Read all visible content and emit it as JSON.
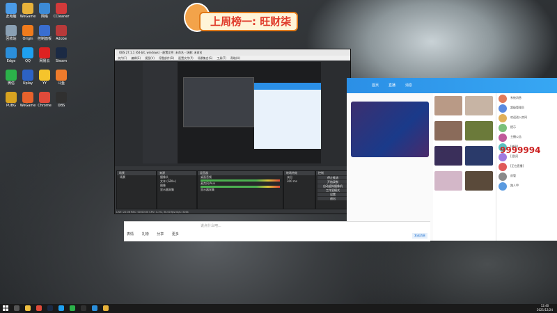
{
  "banner": {
    "text": "上周榜一: 旺财柒"
  },
  "desktop_icons": [
    {
      "label": "此电脑",
      "color": "#4a9be8"
    },
    {
      "label": "WeGame",
      "color": "#e8b23a"
    },
    {
      "label": "网络",
      "color": "#3c8ad6"
    },
    {
      "label": "CCleaner",
      "color": "#d23a3a"
    },
    {
      "label": "回收站",
      "color": "#8aa0b4"
    },
    {
      "label": "Origin",
      "color": "#f07b1c"
    },
    {
      "label": "控制面板",
      "color": "#3a6ed0"
    },
    {
      "label": "Adobe",
      "color": "#b83a3a"
    },
    {
      "label": "Edge",
      "color": "#2b8fdb"
    },
    {
      "label": "QQ",
      "color": "#1ea0f0"
    },
    {
      "label": "网易云",
      "color": "#d22"
    },
    {
      "label": "Steam",
      "color": "#1b2a44"
    },
    {
      "label": "微信",
      "color": "#2bb14a"
    },
    {
      "label": "Uplay",
      "color": "#2c62c5"
    },
    {
      "label": "YY",
      "color": "#f5c42c"
    },
    {
      "label": "斗鱼",
      "color": "#ef7b2c"
    },
    {
      "label": "PUBG",
      "color": "#d8a320"
    },
    {
      "label": "WeGame",
      "color": "#e8622c"
    },
    {
      "label": "Chrome",
      "color": "#e04a3a"
    },
    {
      "label": "OBS",
      "color": "#303030"
    }
  ],
  "obs": {
    "title": "OBS 27.1.1 (64-bit, windows) - 配置文件: 未命名 - 场景: 未命名",
    "menu": [
      "文件(F)",
      "编辑(E)",
      "视图(V)",
      "停靠部件(D)",
      "配置文件(P)",
      "场景集合(S)",
      "工具(T)",
      "帮助(H)"
    ],
    "docks": {
      "scenes": {
        "title": "场景",
        "items": [
          "场景"
        ]
      },
      "sources": {
        "title": "来源",
        "items": [
          "摄像头",
          "文本 (GDI+)",
          "图像",
          "显示器采集"
        ]
      },
      "mixer": {
        "title": "混音器",
        "items": [
          "桌面音频",
          "麦克风/Aux",
          "显示器采集"
        ]
      },
      "transitions": {
        "title": "转场特效",
        "items": [
          "淡出",
          "300 ms"
        ]
      },
      "controls": {
        "title": "控制",
        "items": [
          "停止推流",
          "开始录制",
          "启动虚拟摄像机",
          "工作室模式",
          "设置",
          "退出"
        ]
      }
    },
    "status": "LIVE: 22:06  REC: 00:00:00  CPU: 4.1%, 30.00 fps  kb/s: 3264"
  },
  "qq": {
    "big_number": "9999994",
    "messages": [
      "系统消息",
      "超级管理员",
      "欢迎进入房间",
      "提示",
      "主播公告",
      "[神豪]",
      "[活跃]",
      "[正在直播]",
      "房管",
      "路人甲"
    ],
    "tabs": [
      "首页",
      "直播",
      "消息"
    ]
  },
  "chat_input": {
    "placeholder": "说点什么吧...",
    "actions": [
      "表情",
      "礼物",
      "分享",
      "更多"
    ],
    "send_label": "发送消息"
  },
  "taskbar": {
    "time": "12:40",
    "date": "2021/12/24"
  }
}
